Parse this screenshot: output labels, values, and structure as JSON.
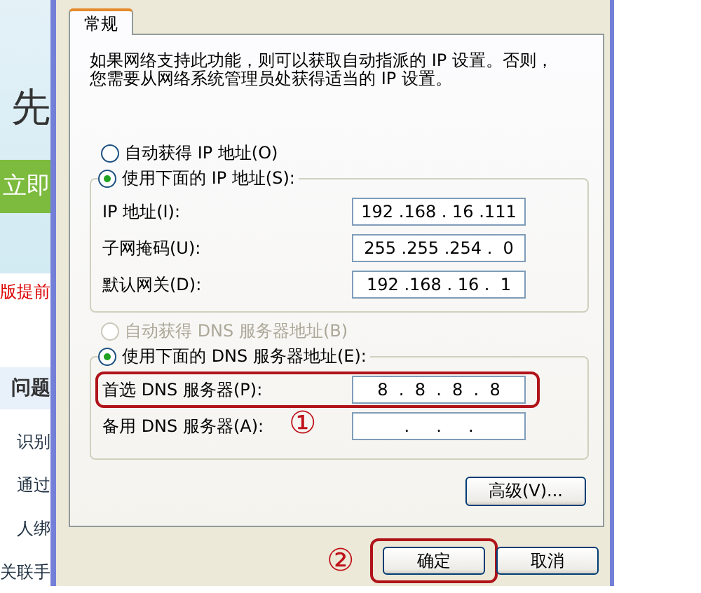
{
  "background_page": {
    "heading": "先",
    "button": "立即",
    "notice": "版提前",
    "section_title": "问题",
    "links": [
      "识别",
      "通过",
      "人绑",
      "关联手"
    ]
  },
  "dialog": {
    "tabs": [
      {
        "label": "常规",
        "selected": true
      }
    ],
    "description_lines": [
      "如果网络支持此功能，则可以获取自动指派的 IP 设置。否则，",
      "您需要从网络系统管理员处获得适当的 IP 设置。"
    ],
    "ip_options": [
      {
        "label": "自动获得 IP 地址(O)",
        "selected": false,
        "disabled": false
      },
      {
        "label": "使用下面的 IP 地址(S):",
        "selected": true,
        "disabled": false
      }
    ],
    "ip_fields": [
      {
        "label": "IP 地址(I):",
        "value": "192 .168 . 16 .111"
      },
      {
        "label": "子网掩码(U):",
        "value": "255 .255 .254 .  0"
      },
      {
        "label": "默认网关(D):",
        "value": "192 .168 . 16 .  1"
      }
    ],
    "dns_options": [
      {
        "label": "自动获得 DNS 服务器地址(B)",
        "selected": false,
        "disabled": true
      },
      {
        "label": "使用下面的 DNS 服务器地址(E):",
        "selected": true,
        "disabled": false
      }
    ],
    "dns_fields": [
      {
        "label": "首选 DNS 服务器(P):",
        "value": "8  .  8  .  8  .  8",
        "highlighted": true,
        "marker": "①"
      },
      {
        "label": "备用 DNS 服务器(A):",
        "value": ".     .     .",
        "highlighted": false
      }
    ],
    "advanced_button": "高级(V)...",
    "buttons": [
      {
        "label": "确定",
        "highlighted": true,
        "marker": "②"
      },
      {
        "label": "取消",
        "highlighted": false
      }
    ]
  }
}
